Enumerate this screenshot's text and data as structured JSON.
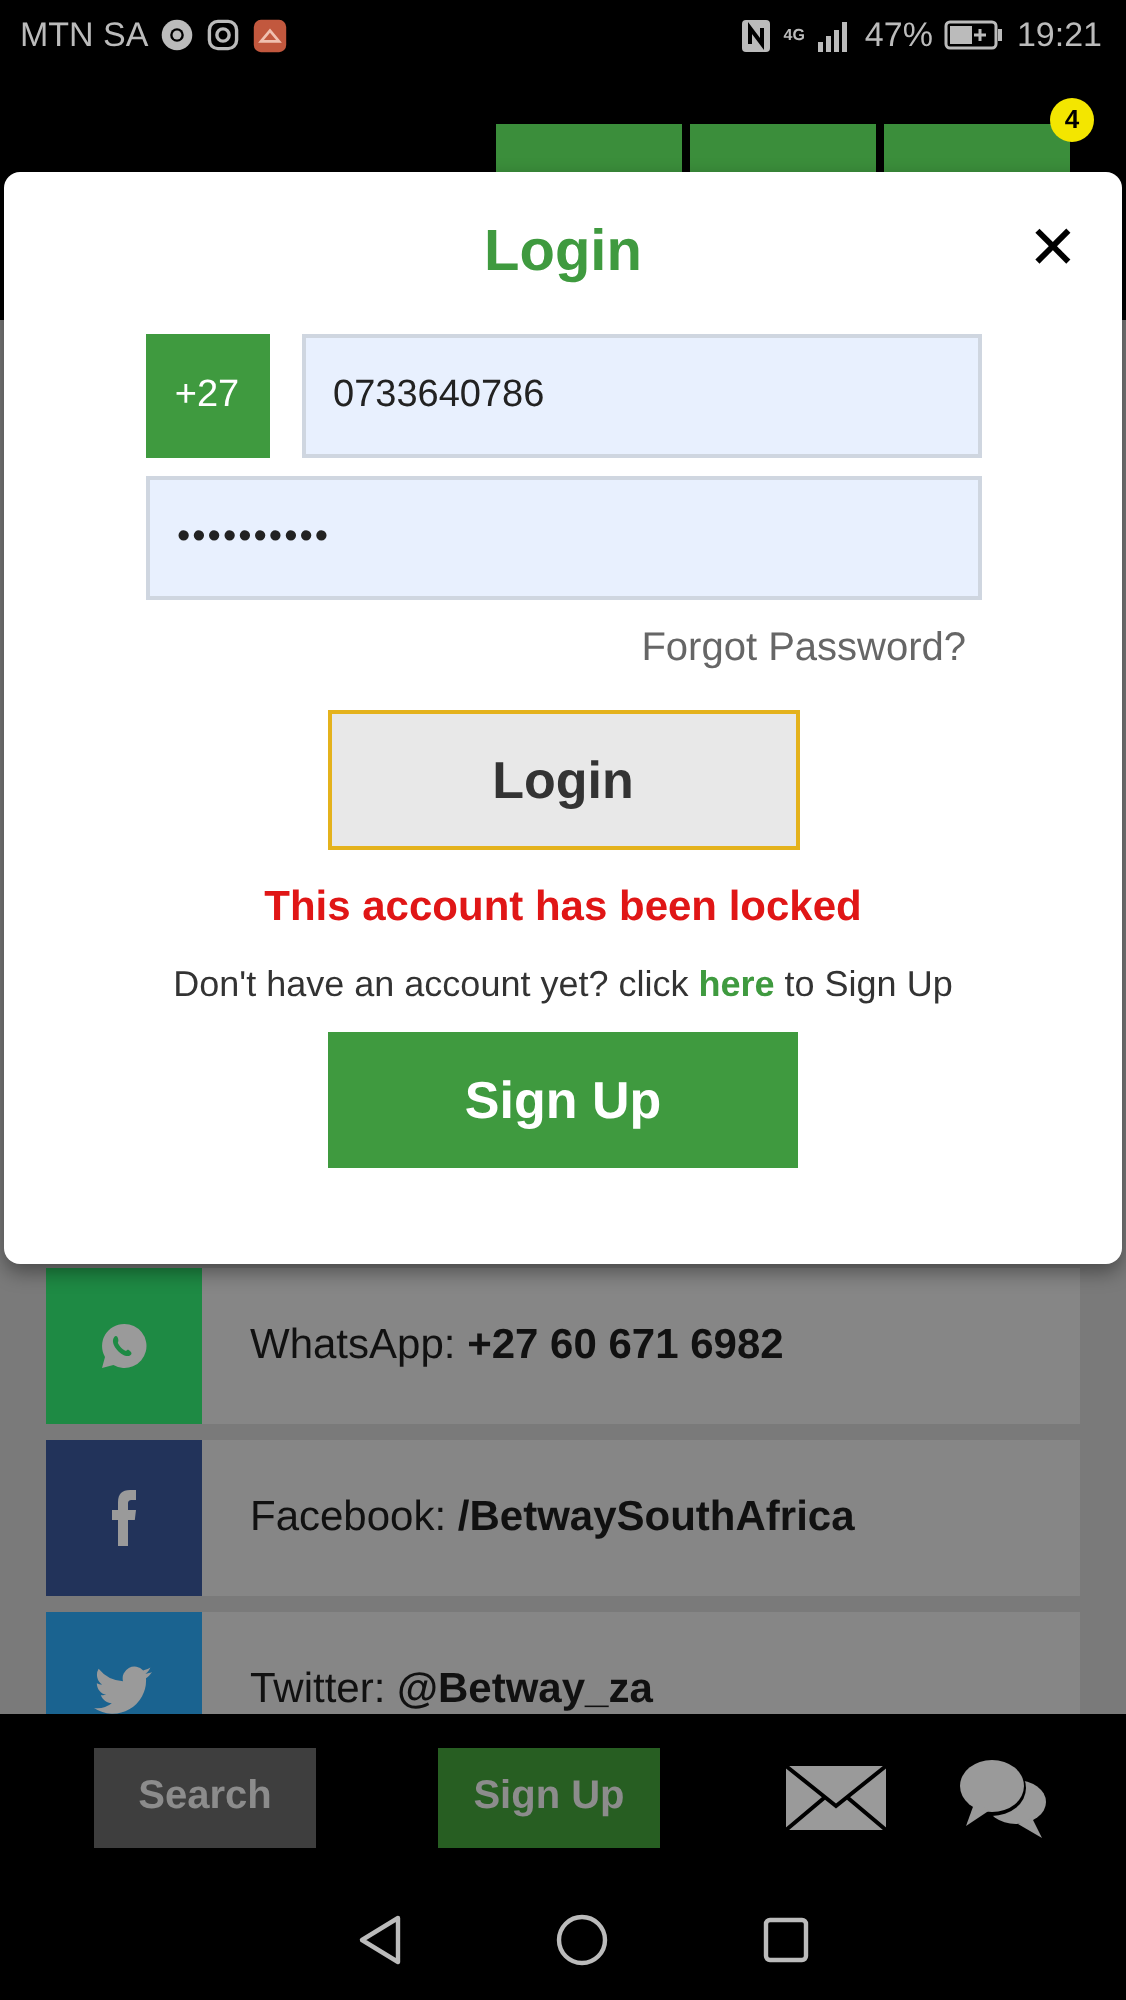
{
  "status_bar": {
    "carrier": "MTN SA",
    "network": "4G",
    "battery": "47%",
    "time": "19:21"
  },
  "header": {
    "betslip_badge": "4"
  },
  "login_dialog": {
    "title": "Login",
    "close": "✕",
    "country_code": "+27",
    "phone": "0733640786",
    "password": "••••••••••",
    "forgot_password": "Forgot Password?",
    "login_button": "Login",
    "error": "This account has been locked",
    "signup_prompt_before": "Don't have an account yet? click ",
    "signup_link": "here",
    "signup_prompt_after": " to Sign Up",
    "signup_button": "Sign Up"
  },
  "contacts": [
    {
      "kind": "whatsapp",
      "color": "#1e8a44",
      "text": "WhatsApp: **+27 60 671 6982**"
    },
    {
      "kind": "facebook",
      "color": "#22335a",
      "text": "Facebook: **/BetwaySouthAfrica**"
    },
    {
      "kind": "twitter",
      "color": "#1a6390",
      "text": "Twitter: **@Betway_za**"
    }
  ],
  "bottom_bar": {
    "search": "Search",
    "signup": "Sign Up"
  }
}
